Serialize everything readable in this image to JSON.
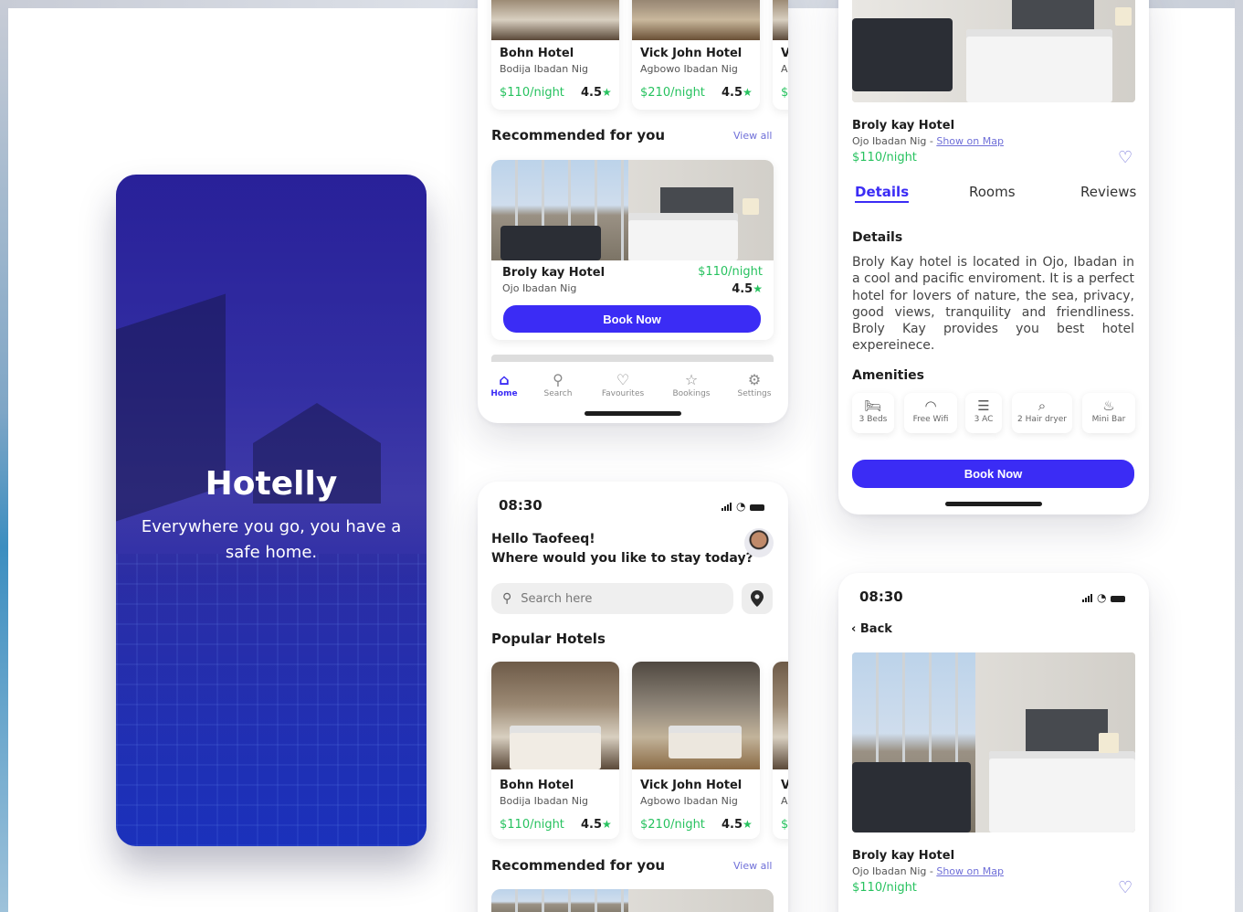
{
  "splash": {
    "title": "Hotelly",
    "tagline": "Everywhere you go, you have a safe home."
  },
  "home_top": {
    "popular": [
      {
        "name": "Bohn Hotel",
        "location": "Bodija Ibadan Nig",
        "price": "$110/night",
        "rating": "4.5"
      },
      {
        "name": "Vick John Hotel",
        "location": "Agbowo Ibadan Nig",
        "price": "$210/night",
        "rating": "4.5"
      },
      {
        "name": "V",
        "location": "A",
        "price": "$",
        "rating": ""
      }
    ],
    "recommended_title": "Recommended for you",
    "view_all": "View all",
    "recommended": {
      "name": "Broly kay Hotel",
      "location": "Ojo Ibadan Nig",
      "price": "$110/night",
      "rating": "4.5"
    },
    "book_now": "Book Now",
    "tabs": [
      {
        "label": "Home",
        "icon": "home-icon"
      },
      {
        "label": "Search",
        "icon": "search-icon"
      },
      {
        "label": "Favourites",
        "icon": "heart-icon"
      },
      {
        "label": "Bookings",
        "icon": "star-icon"
      },
      {
        "label": "Settings",
        "icon": "gear-icon"
      }
    ]
  },
  "home_bottom": {
    "time": "08:30",
    "greeting": "Hello Taofeeq!",
    "question": "Where would you like to stay today?",
    "search_placeholder": "Search here",
    "popular_title": "Popular Hotels",
    "popular": [
      {
        "name": "Bohn Hotel",
        "location": "Bodija Ibadan Nig",
        "price": "$110/night",
        "rating": "4.5"
      },
      {
        "name": "Vick John Hotel",
        "location": "Agbowo Ibadan Nig",
        "price": "$210/night",
        "rating": "4.5"
      },
      {
        "name": "V",
        "location": "A",
        "price": "$",
        "rating": ""
      }
    ],
    "recommended_title": "Recommended for you",
    "view_all": "View all"
  },
  "detail_top": {
    "name": "Broly kay Hotel",
    "location": "Ojo Ibadan Nig -",
    "map_link": "Show on Map",
    "price": "$110/night",
    "tabs": [
      "Details",
      "Rooms",
      "Reviews"
    ],
    "details_title": "Details",
    "details_text": "Broly Kay hotel is located in Ojo, Ibadan in a cool and pacific enviroment. It is a perfect hotel for lovers of nature, the sea, privacy, good views, tranquility and friendliness. Broly Kay provides you best hotel expereinece.",
    "amenities_title": "Amenities",
    "amenities": [
      {
        "label": "3 Beds",
        "icon": "bed-icon"
      },
      {
        "label": "Free Wifi",
        "icon": "wifi-icon"
      },
      {
        "label": "3 AC",
        "icon": "ac-icon"
      },
      {
        "label": "2 Hair dryer",
        "icon": "hair-dryer-icon"
      },
      {
        "label": "Mini Bar",
        "icon": "mini-bar-icon"
      }
    ],
    "book_now": "Book Now"
  },
  "detail_bottom": {
    "time": "08:30",
    "back": "Back",
    "name": "Broly kay Hotel",
    "location": "Ojo Ibadan Nig -",
    "map_link": "Show on Map",
    "price": "$110/night"
  },
  "colors": {
    "accent": "#3b2cf5",
    "price": "#27c25f",
    "link": "#6f6fd8"
  }
}
